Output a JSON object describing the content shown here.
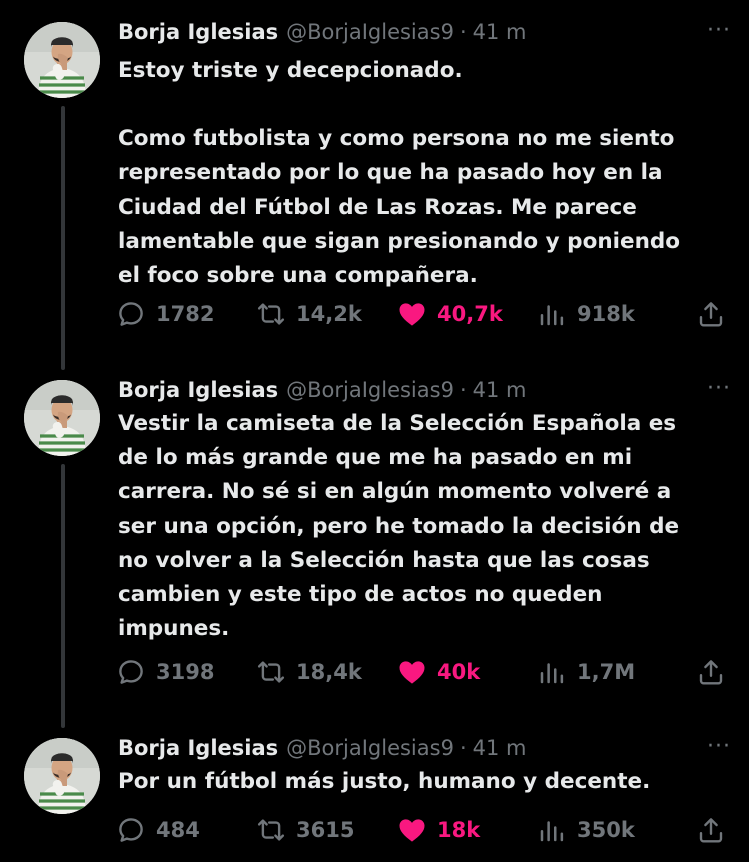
{
  "tweets": [
    {
      "author_name": "Borja Iglesias",
      "handle": "@BorjaIglesias9",
      "separator": "·",
      "time": "41 m",
      "more": "···",
      "paragraphs": [
        [
          "Estoy triste y decepcionado."
        ],
        [
          "Como futbolista y como persona no me siento",
          "representado por lo que ha pasado hoy en la",
          "Ciudad del Fútbol de Las Rozas. Me parece",
          "lamentable que sigan presionando y poniendo",
          "el foco sobre una compañera."
        ]
      ],
      "replies": "1782",
      "retweets": "14,2k",
      "likes": "40,7k",
      "views": "918k"
    },
    {
      "author_name": "Borja Iglesias",
      "handle": "@BorjaIglesias9",
      "separator": "·",
      "time": "41 m",
      "more": "···",
      "paragraphs": [
        [
          "Vestir la camiseta de la Selección Española es",
          "de lo más grande que me ha pasado en mi",
          "carrera. No sé si en algún momento volveré a",
          "ser una opción, pero he tomado la decisión de",
          "no volver a la Selección hasta que las cosas",
          "cambien y este tipo de actos no queden",
          "impunes."
        ]
      ],
      "replies": "3198",
      "retweets": "18,4k",
      "likes": "40k",
      "views": "1,7M"
    },
    {
      "author_name": "Borja Iglesias",
      "handle": "@BorjaIglesias9",
      "separator": "·",
      "time": "41 m",
      "more": "···",
      "paragraphs": [
        [
          "Por un fútbol más justo, humano y decente."
        ]
      ],
      "replies": "484",
      "retweets": "3615",
      "likes": "18k",
      "views": "350k"
    }
  ],
  "colors": {
    "background": "#000000",
    "text": "#e7e9ea",
    "secondary": "#71767b",
    "like": "#f91880",
    "thread_line": "#333639"
  },
  "icons": [
    "reply-icon",
    "retweet-icon",
    "like-heart-icon",
    "views-chart-icon",
    "share-icon",
    "more-options-icon"
  ]
}
